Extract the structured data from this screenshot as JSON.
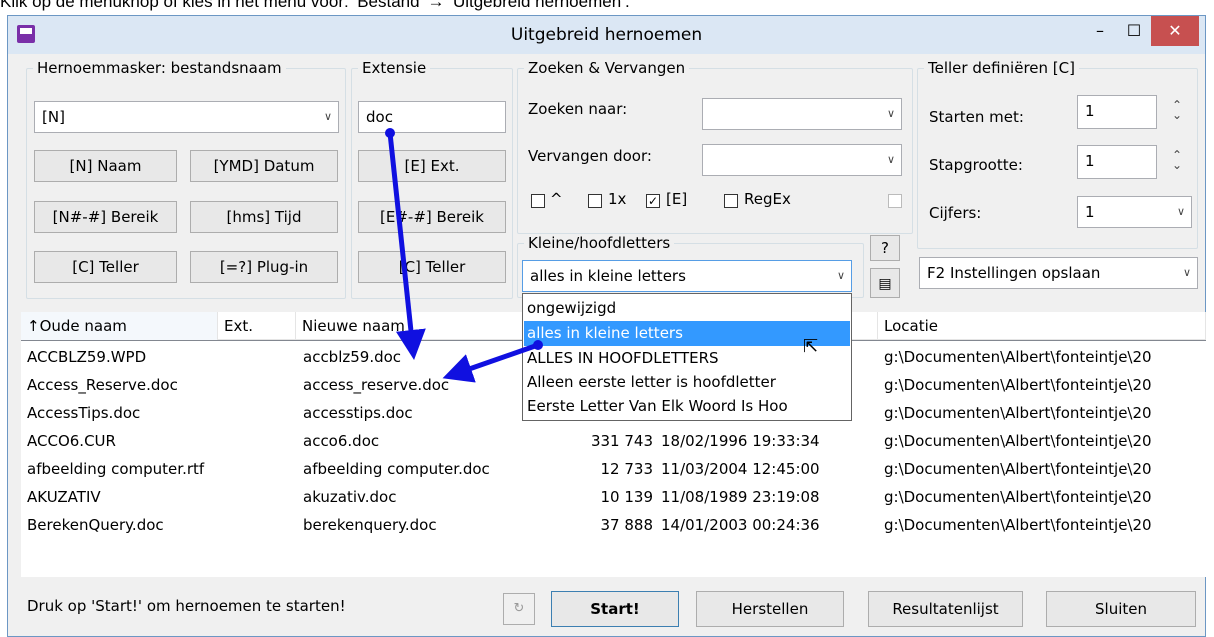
{
  "caption": "Klik op de menuknop of kies in het menu voor: ‘Bestand’ → ‘Uitgebreid hernoemen’.",
  "window": {
    "title": "Uitgebreid hernoemen",
    "minimize": "–",
    "maximize": "☐",
    "close": "✕"
  },
  "mask": {
    "legend": "Hernoemmasker: bestandsnaam",
    "value": "[N]",
    "buttons": [
      "[N]  Naam",
      "[YMD]  Datum",
      "[N#-#] Bereik",
      "[hms]  Tijd",
      "[C]  Teller",
      "[=?]  Plug-in"
    ]
  },
  "ext": {
    "legend": "Extensie",
    "value": "doc",
    "buttons": [
      "[E]  Ext.",
      "[E#-#] Bereik",
      "[C]  Teller"
    ]
  },
  "search": {
    "legend": "Zoeken & Vervangen",
    "search_label": "Zoeken naar:",
    "replace_label": "Vervangen door:",
    "checks": [
      {
        "label": "^",
        "checked": false
      },
      {
        "label": "1x",
        "checked": false
      },
      {
        "label": "[E]",
        "checked": true
      },
      {
        "label": "RegEx",
        "checked": false
      }
    ],
    "case_legend": "Kleine/hoofdletters",
    "case_value": "alles in kleine letters",
    "help": "?"
  },
  "counter": {
    "legend": "Teller definiëren [C]",
    "start_label": "Starten met:",
    "start_value": "1",
    "step_label": "Stapgrootte:",
    "step_value": "1",
    "digits_label": "Cijfers:",
    "digits_value": "1",
    "settings": "F2 Instellingen opslaan"
  },
  "dropdown": {
    "options": [
      "ongewijzigd",
      "alles in kleine letters",
      "ALLES IN HOOFDLETTERS",
      "Alleen eerste letter is hoofdletter",
      "Eerste Letter Van Elk Woord Is Hoo"
    ],
    "selected_index": 1
  },
  "columns": [
    "↑Oude naam",
    "Ext.",
    "Nieuwe naam",
    "Locatie"
  ],
  "rows": [
    {
      "old": "ACCBLZ59.WPD",
      "new": "accblz59.doc",
      "size": "",
      "date": "",
      "loc": "g:\\Documenten\\Albert\\fonteintje\\20"
    },
    {
      "old": "Access_Reserve.doc",
      "new": "access_reserve.doc",
      "size": "",
      "date": "",
      "loc": "g:\\Documenten\\Albert\\fonteintje\\20"
    },
    {
      "old": "AccessTips.doc",
      "new": "accesstips.doc",
      "size": "",
      "date": "",
      "loc": "g:\\Documenten\\Albert\\fonteintje\\20"
    },
    {
      "old": "ACCO6.CUR",
      "new": "acco6.doc",
      "size": "331 743",
      "date": "18/02/1996 19:33:34",
      "loc": "g:\\Documenten\\Albert\\fonteintje\\20"
    },
    {
      "old": "afbeelding computer.rtf",
      "new": "afbeelding computer.doc",
      "size": "12 733",
      "date": "11/03/2004 12:45:00",
      "loc": "g:\\Documenten\\Albert\\fonteintje\\20"
    },
    {
      "old": "AKUZATIV",
      "new": "akuzativ.doc",
      "size": "10 139",
      "date": "11/08/1989 23:19:08",
      "loc": "g:\\Documenten\\Albert\\fonteintje\\20"
    },
    {
      "old": "BerekenQuery.doc",
      "new": "berekenquery.doc",
      "size": "37 888",
      "date": "14/01/2003 00:24:36",
      "loc": "g:\\Documenten\\Albert\\fonteintje\\20"
    }
  ],
  "status": {
    "message": "Druk op 'Start!' om hernoemen te starten!",
    "start": "Start!",
    "restore": "Herstellen",
    "results": "Resultatenlijst",
    "close": "Sluiten"
  },
  "colors": {
    "arrow": "#1010e0",
    "selection": "#3399ff",
    "close_button": "#c75050"
  }
}
